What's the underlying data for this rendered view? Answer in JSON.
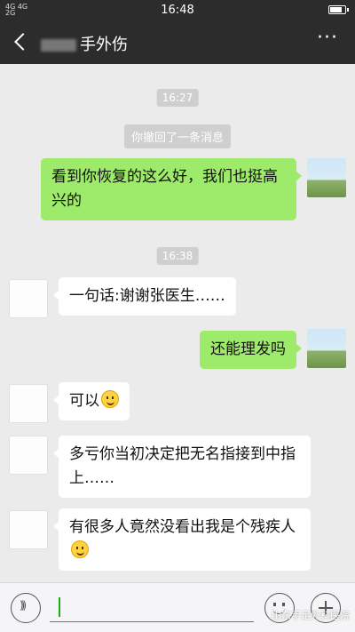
{
  "status_bar": {
    "network_top": "4G 4G",
    "network_bottom": "2G",
    "time": "16:48",
    "battery_level": 0.8
  },
  "header": {
    "title": "手外伤",
    "more_label": "···"
  },
  "messages": [
    {
      "kind": "timestamp",
      "text": "16:27"
    },
    {
      "kind": "system",
      "text": "你撤回了一条消息"
    },
    {
      "kind": "outgoing",
      "text": "看到你恢复的这么好，我们也挺高兴的"
    },
    {
      "kind": "timestamp",
      "text": "16:38"
    },
    {
      "kind": "incoming",
      "text": "一句话:谢谢张医生……"
    },
    {
      "kind": "outgoing",
      "text": "还能理发吗"
    },
    {
      "kind": "incoming",
      "text": "可以",
      "emoji": "smile"
    },
    {
      "kind": "incoming",
      "text": "多亏你当初决定把无名指接到中指上……"
    },
    {
      "kind": "incoming",
      "text": "有很多人竟然没看出我是个残疾人",
      "emoji": "grin"
    }
  ],
  "input": {
    "value": ""
  },
  "watermark": "山东手足外科医院",
  "colors": {
    "header_bg": "#2c2c2c",
    "outgoing_bubble": "#9eea6a",
    "incoming_bubble": "#ffffff",
    "chat_bg": "#ebebeb",
    "accent": "#1aad19"
  }
}
